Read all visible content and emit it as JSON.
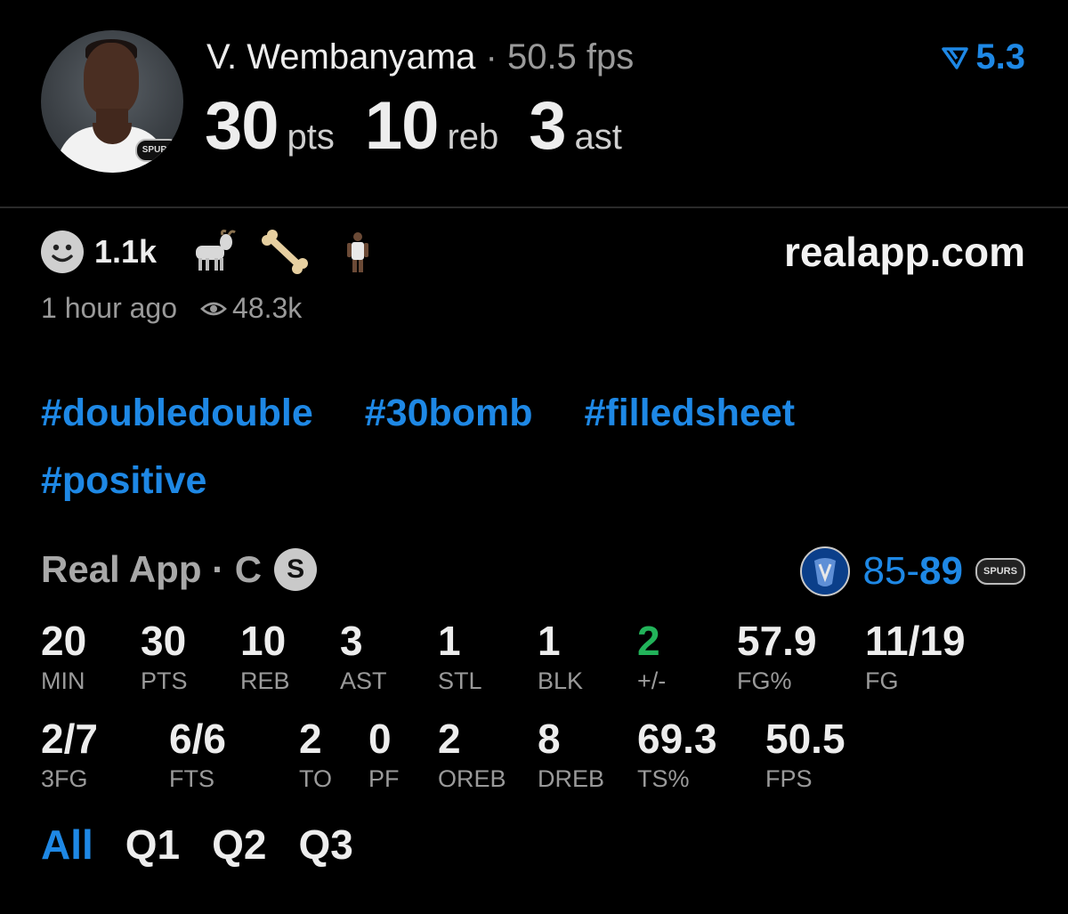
{
  "player": {
    "name": "V. Wembanyama",
    "fps_header": "· 50.5 fps",
    "rating": "5.3",
    "team_logo_text": "SPURS",
    "statline": [
      {
        "value": "30",
        "unit": "pts"
      },
      {
        "value": "10",
        "unit": "reb"
      },
      {
        "value": "3",
        "unit": "ast"
      }
    ]
  },
  "reactions": {
    "count": "1.1k",
    "icons": [
      "smiley-icon",
      "goat-icon",
      "bone-icon",
      "player-icon"
    ]
  },
  "site": "realapp.com",
  "meta": {
    "time_ago": "1 hour ago",
    "views": "48.3k"
  },
  "hashtags": [
    "#doubledouble",
    "#30bomb",
    "#filledsheet",
    "#positive"
  ],
  "game": {
    "source": "Real App · C",
    "badge": "S",
    "score_away": "85",
    "score_sep": "-",
    "score_home": "89",
    "home_logo_text": "SPURS"
  },
  "stats": [
    {
      "value": "20",
      "label": "MIN"
    },
    {
      "value": "30",
      "label": "PTS"
    },
    {
      "value": "10",
      "label": "REB"
    },
    {
      "value": "3",
      "label": "AST"
    },
    {
      "value": "1",
      "label": "STL"
    },
    {
      "value": "1",
      "label": "BLK"
    },
    {
      "value": "2",
      "label": "+/-"
    },
    {
      "value": "57.9",
      "label": "FG%"
    },
    {
      "value": "11/19",
      "label": "FG"
    },
    {
      "value": "2/7",
      "label": "3FG"
    },
    {
      "value": "6/6",
      "label": "FTS"
    },
    {
      "value": "2",
      "label": "TO"
    },
    {
      "value": "0",
      "label": "PF"
    },
    {
      "value": "2",
      "label": "OREB"
    },
    {
      "value": "8",
      "label": "DREB"
    },
    {
      "value": "69.3",
      "label": "TS%"
    },
    {
      "value": "50.5",
      "label": "FPS"
    }
  ],
  "tabs": [
    "All",
    "Q1",
    "Q2",
    "Q3"
  ],
  "colors": {
    "accent": "#1e88e5",
    "positive": "#22b35a",
    "background": "#000000"
  }
}
